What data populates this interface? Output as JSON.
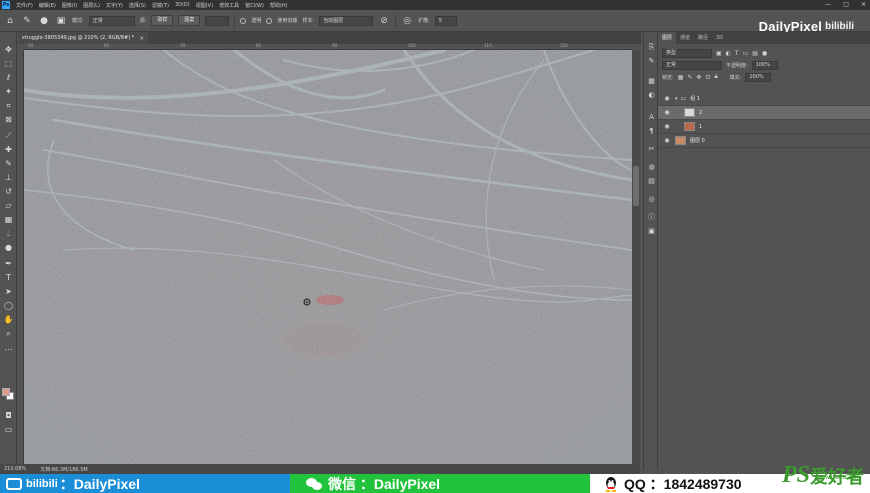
{
  "app": {
    "menu": [
      "文件(F)",
      "编辑(E)",
      "图像(I)",
      "图层(L)",
      "文字(Y)",
      "选择(S)",
      "滤镜(T)",
      "3D(D)",
      "视图(V)",
      "增效工具",
      "窗口(W)",
      "帮助(H)"
    ],
    "window_controls": [
      "—",
      "□",
      "✕"
    ]
  },
  "options": {
    "mode_label": "模式:",
    "mode_value": "正常",
    "source_label": "源:",
    "sample_button": "取样",
    "pattern_button": "图案",
    "transparent_label": "透明",
    "use_legacy_label": "使用旧版",
    "sample_label": "样本:",
    "sample_value": "当前图层",
    "diffusion_label": "扩散:",
    "diffusion_value": "5"
  },
  "brand": {
    "name": "DailyPixel",
    "bilibili": "bilibili"
  },
  "document": {
    "tab_title": "struggle-3805349.jpg @ 210% (2, RGB/8#) *",
    "close_glyph": "×",
    "ruler_labels": [
      "50",
      "60",
      "70",
      "80",
      "90",
      "100",
      "110",
      "120"
    ]
  },
  "status": {
    "zoom": "210.08%",
    "doc_size": "文档:66.3M/186.5M"
  },
  "layers_panel": {
    "tabs": [
      "图层",
      "通道",
      "路径",
      "3D"
    ],
    "filter_label": "类型",
    "blend_mode": "正常",
    "opacity_label": "不透明度:",
    "opacity_value": "100%",
    "lock_label": "锁定:",
    "fill_label": "填充:",
    "fill_value": "100%",
    "layers": [
      {
        "name": "组 1",
        "kind": "group",
        "selected": false
      },
      {
        "name": "2",
        "kind": "blank",
        "selected": true
      },
      {
        "name": "1",
        "kind": "photo",
        "selected": false
      },
      {
        "name": "图层 0",
        "kind": "photo2",
        "selected": false
      }
    ]
  },
  "banner": {
    "bili_text": "bilibili",
    "bili_handle": "：DailyPixel",
    "wechat_text": "微信 ：DailyPixel",
    "qq_text": "QQ ：1842489730",
    "ps_logo": "PS",
    "ps_cn": "爱好者",
    "ps_url": "www.psahz.com"
  },
  "colors": {
    "chrome": "#535353",
    "canvas": "#8b8f93",
    "accent_blue": "#1a8ed6",
    "accent_green": "#22c33c",
    "foreground_swatch": "#d8a08f"
  }
}
